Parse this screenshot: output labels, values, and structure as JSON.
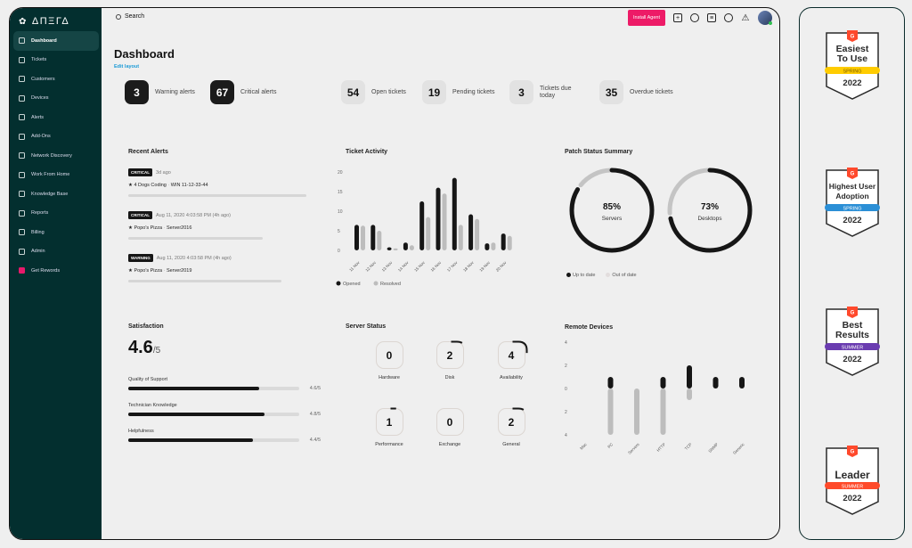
{
  "app": {
    "logo": "ΔΠΞΓΔ",
    "logo_icon": "cluster-icon"
  },
  "sidebar": {
    "items": [
      {
        "label": "Dashboard",
        "icon": "grid-icon",
        "active": true
      },
      {
        "label": "Tickets",
        "icon": "ticket-icon"
      },
      {
        "label": "Customers",
        "icon": "users-icon"
      },
      {
        "label": "Devices",
        "icon": "monitor-icon"
      },
      {
        "label": "Alerts",
        "icon": "warning-icon"
      },
      {
        "label": "Add-Ons",
        "icon": "puzzle-icon",
        "has_chevron": true
      },
      {
        "label": "Network Discovery",
        "icon": "network-icon"
      },
      {
        "label": "Work From Home",
        "icon": "home-icon"
      },
      {
        "label": "Knowledge Base",
        "icon": "book-icon"
      },
      {
        "label": "Reports",
        "icon": "bar-chart-icon"
      },
      {
        "label": "Billing",
        "icon": "billing-icon"
      },
      {
        "label": "Admin",
        "icon": "admin-icon"
      },
      {
        "label": "Get Rewords",
        "icon": "gift-icon"
      }
    ]
  },
  "header": {
    "search_placeholder": "Search",
    "install_agent": "Install Agent",
    "icons": [
      "add-icon",
      "lightbulb-icon",
      "notes-icon",
      "bell-icon",
      "alert-triangle-icon"
    ]
  },
  "page": {
    "title": "Dashboard",
    "edit_layout": "Edit layout"
  },
  "kpis": [
    {
      "value": "3",
      "label": "Warning alerts",
      "style": "dark"
    },
    {
      "value": "67",
      "label": "Critical alerts",
      "style": "dark"
    },
    {
      "value": "54",
      "label": "Open tickets",
      "style": "light"
    },
    {
      "value": "19",
      "label": "Pending tickets",
      "style": "light"
    },
    {
      "value": "3",
      "label": "Tickets due today",
      "style": "light"
    },
    {
      "value": "35",
      "label": "Overdue tickets",
      "style": "light"
    }
  ],
  "recent_alerts": {
    "title": "Recent Alerts",
    "items": [
      {
        "severity": "CRITICAL",
        "time": "3d ago",
        "customer": "4 Dogs Coding",
        "device": "WIN 11-12-33-44",
        "progress": 0.95
      },
      {
        "severity": "CRITICAL",
        "time": "Aug 11, 2020 4:03:58 PM (4h ago)",
        "customer": "Popo's Pizza",
        "device": "Server2016",
        "progress": 0.72
      },
      {
        "severity": "WARNING",
        "time": "Aug 11, 2020 4:03:58 PM (4h ago)",
        "customer": "Popo's Pizza",
        "device": "Server2019",
        "progress": 0.82
      }
    ]
  },
  "satisfaction": {
    "title": "Satisfaction",
    "score": "4.6",
    "out_of": "/5",
    "rows": [
      {
        "label": "Quality of Support",
        "value": 4.6,
        "display": "4.6/5"
      },
      {
        "label": "Technician Knowledge",
        "value": 4.8,
        "display": "4.8/5"
      },
      {
        "label": "Helpfulness",
        "value": 4.4,
        "display": "4.4/5"
      }
    ]
  },
  "server_status": {
    "title": "Server Status",
    "items": [
      {
        "name": "Hardware",
        "value": 0
      },
      {
        "name": "Disk",
        "value": 2
      },
      {
        "name": "Availability",
        "value": 4
      },
      {
        "name": "Performance",
        "value": 1
      },
      {
        "name": "Exchange",
        "value": 0
      },
      {
        "name": "General",
        "value": 2
      }
    ]
  },
  "chart_data": [
    {
      "type": "bar",
      "title": "Ticket Activity",
      "categories": [
        "11 Nov",
        "12 Nov",
        "13 Nov",
        "14 Nov",
        "15 Nov",
        "16 Nov",
        "17 Nov",
        "18 Nov",
        "19 Nov",
        "20 Nov"
      ],
      "series": [
        {
          "name": "Opened",
          "color": "#161616",
          "values": [
            6.5,
            6.5,
            0.8,
            2,
            12.5,
            16,
            18.5,
            9.2,
            1.8,
            4.3
          ]
        },
        {
          "name": "Resolved",
          "color": "#bdbdbd",
          "values": [
            6.3,
            5,
            0.5,
            1.3,
            8.5,
            14.5,
            6.5,
            8,
            2,
            3.7
          ]
        }
      ],
      "yticks": [
        0,
        5,
        10,
        15,
        20
      ],
      "ylim": [
        0,
        20
      ],
      "legend": "bottom-left"
    },
    {
      "type": "pie",
      "title": "Patch Status Summary",
      "series": [
        {
          "name": "Servers",
          "up_to_date": 85,
          "label": "85%"
        },
        {
          "name": "Desktops",
          "up_to_date": 73,
          "label": "73%"
        }
      ],
      "legend_labels": [
        "Up to date",
        "Out of date"
      ],
      "colors": {
        "up_to_date": "#161616",
        "out_of_date": "#c4c4c4"
      },
      "legend": "bottom-left"
    },
    {
      "type": "bar",
      "title": "Remote Devices",
      "categories": [
        "Mac",
        "PC",
        "Servers",
        "HTTP",
        "TCP",
        "SNMP",
        "Generic"
      ],
      "series": [
        {
          "name": "Online",
          "color": "#161616",
          "values": [
            0,
            1,
            0,
            1,
            2,
            1,
            1
          ]
        },
        {
          "name": "Offline",
          "color": "#bdbdbd",
          "values": [
            0,
            -4,
            -4,
            -4,
            -1,
            0,
            0
          ]
        }
      ],
      "yticks": [
        "4",
        "2",
        "0",
        "2",
        "4"
      ],
      "ylim": [
        -4,
        4
      ]
    }
  ],
  "awards": [
    {
      "title": "Easiest To Use",
      "season": "SPRING",
      "year": "2022",
      "ribbon": "#ffcc00",
      "ribbon_text": "#7a5c00"
    },
    {
      "title": "Highest User Adoption",
      "season": "SPRING",
      "year": "2022",
      "ribbon": "#2b8fd6",
      "ribbon_text": "#ffffff"
    },
    {
      "title": "Best Results",
      "season": "SUMMER",
      "year": "2022",
      "ribbon": "#6a3cb0",
      "ribbon_text": "#ffffff"
    },
    {
      "title": "Leader",
      "season": "SUMMER",
      "year": "2022",
      "ribbon": "#ff4a2a",
      "ribbon_text": "#ffffff"
    }
  ]
}
